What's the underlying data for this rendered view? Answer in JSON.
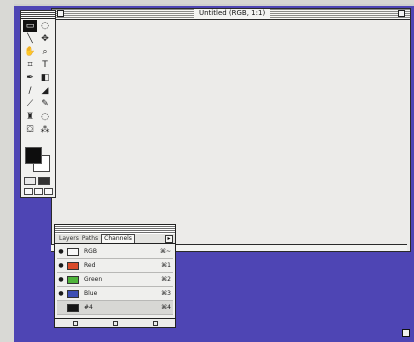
{
  "document": {
    "title": "Untitled (RGB, 1:1)"
  },
  "tools": [
    {
      "name": "marquee-icon",
      "glyph": "▭"
    },
    {
      "name": "lasso-icon",
      "glyph": "◌"
    },
    {
      "name": "line-icon",
      "glyph": "╲"
    },
    {
      "name": "move-icon",
      "glyph": "✥"
    },
    {
      "name": "hand-icon",
      "glyph": "✋"
    },
    {
      "name": "zoom-icon",
      "glyph": "⌕"
    },
    {
      "name": "crop-icon",
      "glyph": "⌗"
    },
    {
      "name": "type-icon",
      "glyph": "T"
    },
    {
      "name": "pen-icon",
      "glyph": "✒"
    },
    {
      "name": "gradient-icon",
      "glyph": "◧"
    },
    {
      "name": "brush-icon",
      "glyph": "∕"
    },
    {
      "name": "eraser-icon",
      "glyph": "◢"
    },
    {
      "name": "airbrush-icon",
      "glyph": "⟋"
    },
    {
      "name": "pencil-icon",
      "glyph": "✎"
    },
    {
      "name": "stamp-icon",
      "glyph": "♜"
    },
    {
      "name": "blur-icon",
      "glyph": "◌"
    },
    {
      "name": "bucket-icon",
      "glyph": "⛋"
    },
    {
      "name": "dropper-icon",
      "glyph": "⁂"
    }
  ],
  "channels_palette": {
    "tabs": [
      "Layers",
      "Paths",
      "Channels"
    ],
    "menu_arrow": "▸",
    "rows": [
      {
        "eye": "●",
        "name": "RGB",
        "shortcut": "⌘~",
        "color": "#f8f8f8"
      },
      {
        "eye": "●",
        "name": "Red",
        "shortcut": "⌘1",
        "color": "#d84b2a"
      },
      {
        "eye": "●",
        "name": "Green",
        "shortcut": "⌘2",
        "color": "#4fb43b"
      },
      {
        "eye": "●",
        "name": "Blue",
        "shortcut": "⌘3",
        "color": "#3d4eb3"
      },
      {
        "eye": "",
        "name": "#4",
        "shortcut": "⌘4",
        "color": "#151515"
      }
    ],
    "footer_icons": [
      "page-icon",
      "trash-icon",
      "new-icon"
    ]
  },
  "colors": {
    "desktop": "#4e45b4",
    "window_bg": "#ecebe9"
  }
}
